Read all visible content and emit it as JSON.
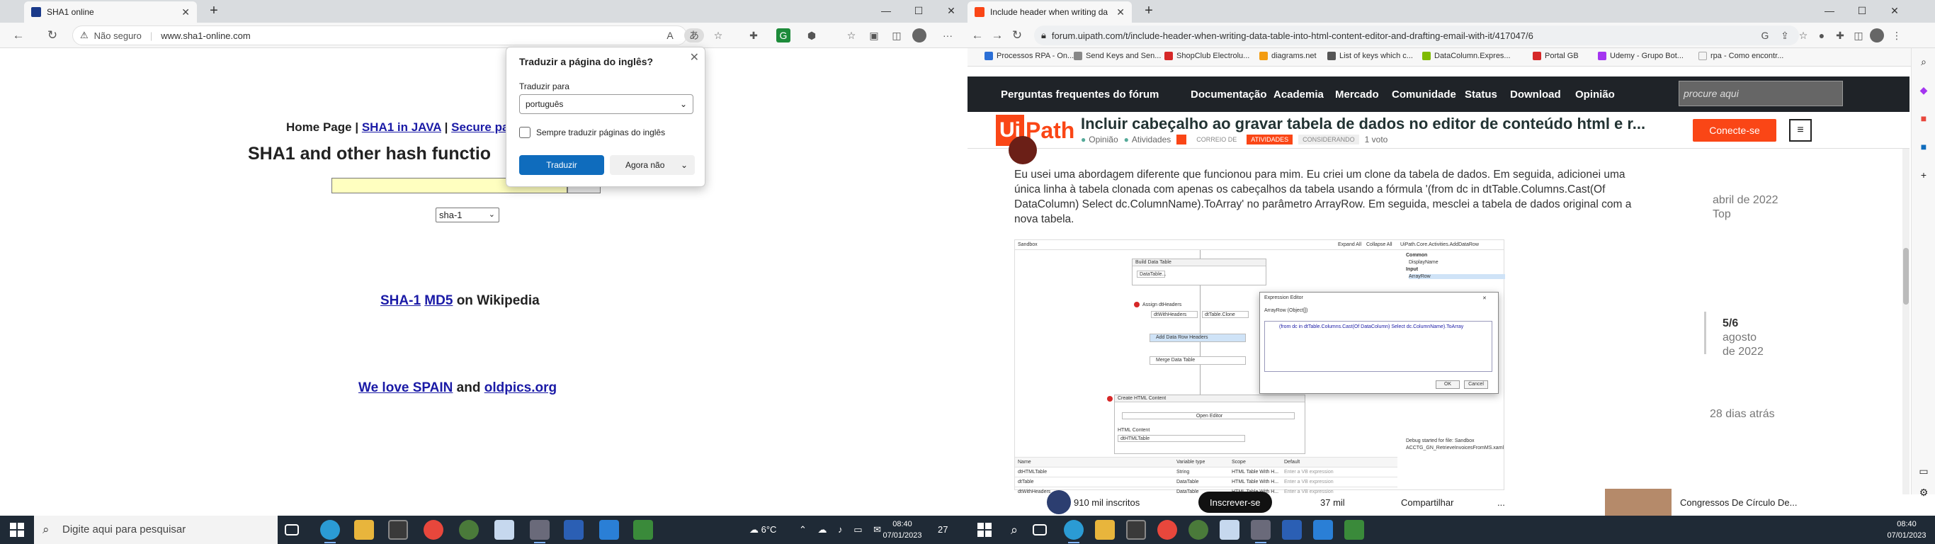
{
  "left": {
    "tab": {
      "title": "SHA1 online"
    },
    "window_controls": {
      "minimize": "—",
      "maximize": "☐",
      "close": "✕"
    },
    "address": {
      "security": "Não seguro",
      "url": "www.sha1-online.com"
    },
    "page": {
      "links": [
        "Home Page",
        "SHA1 in JAVA",
        "Secure pa"
      ],
      "separator": "|",
      "title": "SHA1 and other hash functio",
      "algorithm": "sha-1",
      "wiki_links": [
        "SHA-1",
        "MD5"
      ],
      "wiki_suffix": "on Wikipedia",
      "spain_link": "We love SPAIN",
      "spain_and": "and",
      "oldpics_link": "oldpics.org"
    },
    "translate_popup": {
      "title": "Traduzir a página do inglês?",
      "target_label": "Traduzir para",
      "target_value": "português",
      "always_label": "Sempre traduzir páginas do inglês",
      "translate_button": "Traduzir",
      "not_now_button": "Agora não"
    },
    "taskbar": {
      "search_placeholder": "Digite aqui para pesquisar",
      "temperature": "6°C",
      "time": "08:40",
      "date": "07/01/2023",
      "notifications": "27"
    }
  },
  "right": {
    "tab": {
      "title": "Include header when writing da"
    },
    "window_controls": {
      "minimize": "—",
      "maximize": "☐",
      "close": "✕"
    },
    "address": {
      "url": "forum.uipath.com/t/include-header-when-writing-data-table-into-html-content-editor-and-drafting-email-with-it/417047/6"
    },
    "bookmarks": [
      "Processos RPA - On...",
      "Send Keys and Sen...",
      "ShopClub Electrolu...",
      "diagrams.net",
      "List of keys which c...",
      "DataColumn.Expres...",
      "Portal GB",
      "Udemy - Grupo Bot...",
      "rpa - Como encontr..."
    ],
    "forum_nav": [
      "Perguntas frequentes do fórum",
      "Documentação",
      "Academia",
      "Mercado",
      "Comunidade",
      "Status",
      "Download",
      "Opinião"
    ],
    "search_placeholder": "procure aqui",
    "logo": {
      "ui": "Ui",
      "path": "Path"
    },
    "topic": {
      "title": "Incluir cabeçalho ao gravar tabela de dados no editor de conteúdo html e r...",
      "category": "Opinião",
      "sub_category": "Atividades",
      "tags": [
        "CORREIO DE",
        "ATIVIDADES",
        "CONSIDERANDO"
      ],
      "votes": "1 voto"
    },
    "connect_button": "Conecte-se",
    "post_text": "Eu usei uma abordagem diferente que funcionou para mim. Eu criei um clone da tabela de dados. Em seguida, adicionei uma única linha à tabela clonada com apenas os cabeçalhos da tabela usando a fórmula '(from dc in dtTable.Columns.Cast(Of DataColumn) Select dc.ColumnName).ToArray' no parâmetro ArrayRow. Em seguida, mesclei a tabela de dados original com a nova tabela.",
    "timeline": {
      "top_date": "abril de 2022",
      "top_label": "Top",
      "position": "5/6",
      "month": "agosto",
      "year": "de 2022",
      "ago": "28 dias atrás"
    },
    "studio": {
      "panel_title": "Sandbox",
      "expand_all": "Expand All",
      "collapse_all": "Collapse All",
      "props_title": "UiPath.Core.Activities.AddDataRow",
      "props_common": "Common",
      "props_display": "DisplayName",
      "props_input": "Input",
      "props_arrayrow": "ArrayRow",
      "build_table": "Build Data Table",
      "datatable_btn": "DataTable...",
      "assign": "Assign dtHeaders",
      "assign_left": "dtWithHeaders",
      "assign_right": "dtTable.Clone",
      "add_row": "Add Data Row Headers",
      "merge": "Merge Data Table",
      "create_html": "Create HTML Content",
      "open_editor": "Open Editor",
      "html_content": "HTML Content",
      "html_field": "dtHTMLTable",
      "dialog_title": "Expression Editor",
      "dialog_sub": "ArrayRow (Object[])",
      "dialog_code": "(from dc in dtTable.Columns.Cast(Of DataColumn) Select dc.ColumnName).ToArray",
      "ok": "OK",
      "cancel": "Cancel",
      "output1": "Debug started for file: Sandbox",
      "output2": "ACCTG_GN_RetrieveInvoicesFromMS.xaml",
      "grid_headers": [
        "Name",
        "Variable type",
        "Scope",
        "Default"
      ],
      "grid_rows": [
        [
          "dtHTMLTable",
          "String",
          "HTML Table With H...",
          "Enter a VB expression"
        ],
        [
          "dtTable",
          "DataTable",
          "HTML Table With H...",
          "Enter a VB expression"
        ],
        [
          "dtWithHeaders",
          "DataTable",
          "HTML Table With H...",
          "Enter a VB expression"
        ]
      ]
    },
    "yt_strip": {
      "subscribers": "910 mil inscritos",
      "subscribe": "Inscrever-se",
      "likes": "37 mil",
      "share": "Compartilhar",
      "more": "...",
      "video_title": "Congressos De Círculo De..."
    },
    "taskbar": {
      "time": "08:40",
      "date": "07/01/2023"
    }
  }
}
